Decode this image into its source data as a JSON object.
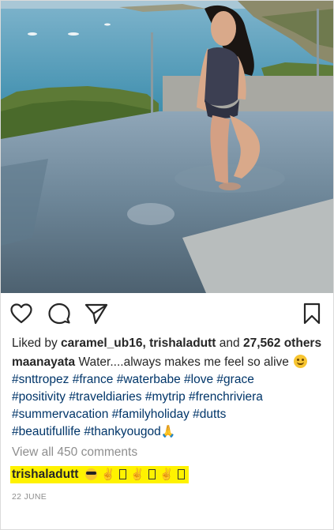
{
  "post": {
    "likes": {
      "prefix": "Liked by",
      "user_1": "caramel_ub16,",
      "user_2": "trishaladutt",
      "and_word": "and",
      "count": "27,562",
      "suffix": "others"
    },
    "caption": {
      "username": "maanayata",
      "text": "Water....always makes me feel so alive",
      "hashtags_line1": [
        "#snttropez",
        "#france",
        "#waterbabe",
        "#love",
        "#grace"
      ],
      "hashtags_line2": [
        "#positivity",
        "#traveldiaries",
        "#mytrip",
        "#frenchriviera"
      ],
      "hashtags_line3": [
        "#summervacation",
        "#familyholiday",
        "#dutts"
      ],
      "hashtags_line4": [
        "#beautifullife",
        "#thankyougod"
      ]
    },
    "view_all_comments": "View all 450 comments",
    "comment": {
      "username": "trishaladutt"
    },
    "date": "22 JUNE"
  },
  "icons": {
    "like": "heart-outline-icon",
    "comment": "speech-bubble-icon",
    "share": "paper-plane-icon",
    "save": "bookmark-icon"
  },
  "colors": {
    "text": "#262626",
    "hashtag": "#003569",
    "muted": "#8e8e8e",
    "highlight": "#fff200"
  }
}
